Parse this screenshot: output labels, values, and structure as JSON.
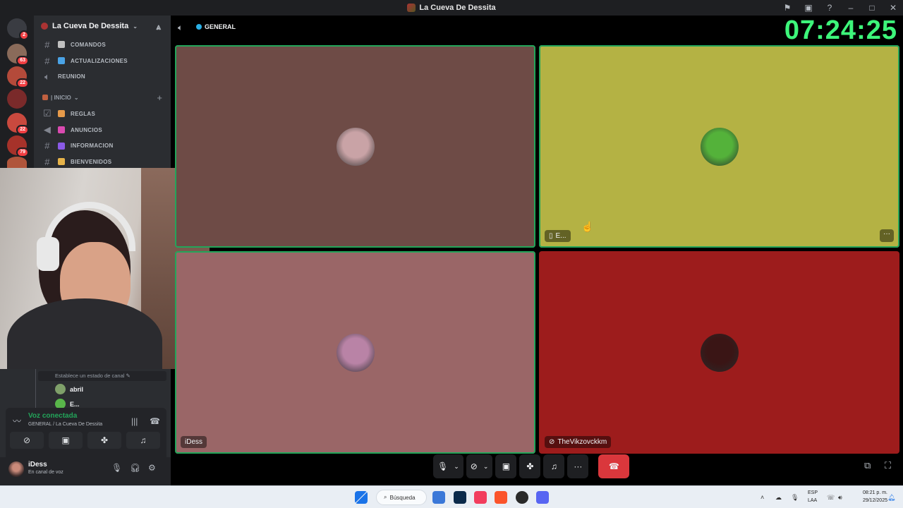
{
  "window": {
    "title": "La Cueva De Dessita"
  },
  "server": {
    "name": "La Cueva De Dessita"
  },
  "rail": {
    "servers": [
      {
        "badge": "2",
        "color": "#6d5a55"
      },
      {
        "badge": "63",
        "color": "#8a6b5a"
      },
      {
        "badge": "22",
        "color": "#b44a3a"
      },
      {
        "badge": "",
        "color": "#7a2a2a"
      },
      {
        "badge": "22",
        "color": "#c9493e"
      },
      {
        "badge": "79",
        "color": "#a6322a"
      },
      {
        "badge": "",
        "color": "#b0553b"
      }
    ]
  },
  "channels": [
    {
      "label": "COMANDOS",
      "icon": "hash",
      "emoji_color": "#c0c0c0"
    },
    {
      "label": "ACTUALIZACIONES",
      "icon": "hash",
      "emoji_color": "#4aa3e6"
    },
    {
      "label": "REUNION",
      "icon": "speaker",
      "emoji_color": ""
    }
  ],
  "category": {
    "label": "| INICIO"
  },
  "inicio_channels": [
    {
      "label": "REGLAS",
      "icon": "rules",
      "emoji_color": "#e69a4a"
    },
    {
      "label": "ANUNCIOS",
      "icon": "megaphone",
      "emoji_color": "#d94ab0"
    },
    {
      "label": "INFORMACION",
      "icon": "hash",
      "emoji_color": "#8a5ae6"
    },
    {
      "label": "BIENVENIDOS",
      "icon": "hash",
      "emoji_color": "#e6b34a"
    }
  ],
  "voice_list": {
    "status_placeholder": "Establece un estado de canal",
    "users": [
      {
        "name": "abril",
        "color": "#7fa06a"
      },
      {
        "name": "E...",
        "color": "#59b64a"
      }
    ]
  },
  "voice_connected": {
    "title": "Voz conectada",
    "subtitle": "GENERAL / La Cueva De Dessita"
  },
  "user": {
    "name": "iDess",
    "status": "En canal de voz"
  },
  "voice_header": {
    "channel": "GENERAL"
  },
  "clock": "07:24:25",
  "tiles": [
    {
      "name": "",
      "bg": "#6e4b46",
      "avatar": "#c9a3a6",
      "speaking": true
    },
    {
      "name": "E...",
      "bg": "#b4b244",
      "avatar": "#54b23a",
      "speaking": true,
      "has_more": true
    },
    {
      "name": "iDess",
      "bg": "#9a6667",
      "avatar": "#b983a6",
      "speaking": true
    },
    {
      "name": "TheVikzovckkm",
      "bg": "#9d1c1c",
      "avatar": "#3a1515",
      "speaking": false,
      "muted": true
    }
  ],
  "taskbar": {
    "search_label": "Búsqueda",
    "lang_line1": "ESP",
    "lang_line2": "LAA",
    "time": "08:21 p. m.",
    "date": "29/12/2025"
  }
}
